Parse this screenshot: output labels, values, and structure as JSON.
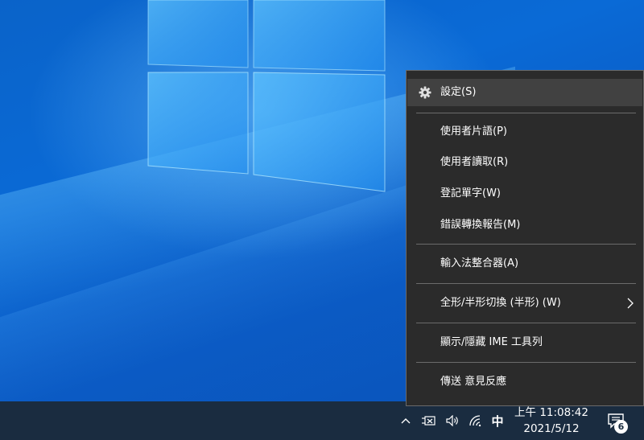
{
  "colors": {
    "desktop_blue": "#0a63c9",
    "taskbar": "#1a2c40",
    "menu_bg": "#2b2b2b",
    "menu_hover": "#414141",
    "separator": "#6b6b6b"
  },
  "context_menu": {
    "settings": {
      "label": "設定(S)",
      "icon": "gear-icon"
    },
    "user_phrases": "使用者片語(P)",
    "user_read": "使用者讀取(R)",
    "register_word": "登記單字(W)",
    "report_error": "錯誤轉換報告(M)",
    "ime_integrator": "輸入法整合器(A)",
    "full_half_toggle": {
      "label": "全形/半形切換 (半形) (W)",
      "icon": "chevron-right-icon"
    },
    "show_hide_toolbar": "顯示/隱藏 IME  工具列",
    "send_feedback": "傳送  意見反應"
  },
  "taskbar": {
    "tray": {
      "show_hidden_icons": "chevron-up-icon",
      "network_icon": "ethernet-disconnected-icon",
      "volume_icon": "speaker-icon",
      "wifi_icon": "wifi-icon",
      "ime_mode": "中"
    },
    "clock": {
      "time": "上午 11:08:42",
      "date": "2021/5/12"
    },
    "notifications": {
      "icon": "notification-icon",
      "count": "6"
    }
  }
}
